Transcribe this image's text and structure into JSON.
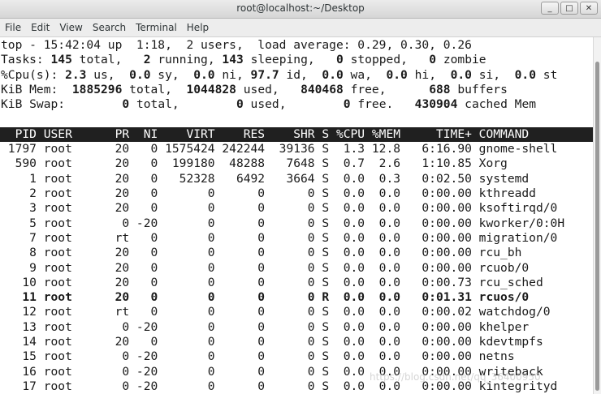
{
  "window": {
    "title": "root@localhost:~/Desktop"
  },
  "menu": [
    "File",
    "Edit",
    "View",
    "Search",
    "Terminal",
    "Help"
  ],
  "summary": {
    "uptime": "top - 15:42:04 up  1:18,  2 users,  load average: 0.29, 0.30, 0.26",
    "tasks": [
      "Tasks: ",
      "145",
      " total,   ",
      "2",
      " running, ",
      "143",
      " sleeping,   ",
      "0",
      " stopped,   ",
      "0",
      " zombie"
    ],
    "cpu": [
      "%Cpu(s): ",
      "2.3",
      " us,  ",
      "0.0",
      " sy,  ",
      "0.0",
      " ni, ",
      "97.7",
      " id,  ",
      "0.0",
      " wa,  ",
      "0.0",
      " hi,  ",
      "0.0",
      " si,  ",
      "0.0",
      " st"
    ],
    "mem": [
      "KiB Mem:  ",
      "1885296",
      " total,  ",
      "1044828",
      " used,   ",
      "840468",
      " free,      ",
      "688",
      " buffers"
    ],
    "swap": [
      "KiB Swap:        ",
      "0",
      " total,        ",
      "0",
      " used,        ",
      "0",
      " free.   ",
      "430904",
      " cached Mem"
    ]
  },
  "header": "  PID USER      PR  NI    VIRT    RES    SHR S %CPU %MEM     TIME+ COMMAND     ",
  "processes": [
    [
      "1797",
      "root",
      "20",
      "0",
      "1575424",
      "242244",
      "39136",
      "S",
      "1.3",
      "12.8",
      "6:16.90",
      "gnome-shell"
    ],
    [
      "590",
      "root",
      "20",
      "0",
      "199180",
      "48288",
      "7648",
      "S",
      "0.7",
      "2.6",
      "1:10.85",
      "Xorg"
    ],
    [
      "1",
      "root",
      "20",
      "0",
      "52328",
      "6492",
      "3664",
      "S",
      "0.0",
      "0.3",
      "0:02.50",
      "systemd"
    ],
    [
      "2",
      "root",
      "20",
      "0",
      "0",
      "0",
      "0",
      "S",
      "0.0",
      "0.0",
      "0:00.00",
      "kthreadd"
    ],
    [
      "3",
      "root",
      "20",
      "0",
      "0",
      "0",
      "0",
      "S",
      "0.0",
      "0.0",
      "0:00.00",
      "ksoftirqd/0"
    ],
    [
      "5",
      "root",
      "0",
      "-20",
      "0",
      "0",
      "0",
      "S",
      "0.0",
      "0.0",
      "0:00.00",
      "kworker/0:0H"
    ],
    [
      "7",
      "root",
      "rt",
      "0",
      "0",
      "0",
      "0",
      "S",
      "0.0",
      "0.0",
      "0:00.00",
      "migration/0"
    ],
    [
      "8",
      "root",
      "20",
      "0",
      "0",
      "0",
      "0",
      "S",
      "0.0",
      "0.0",
      "0:00.00",
      "rcu_bh"
    ],
    [
      "9",
      "root",
      "20",
      "0",
      "0",
      "0",
      "0",
      "S",
      "0.0",
      "0.0",
      "0:00.00",
      "rcuob/0"
    ],
    [
      "10",
      "root",
      "20",
      "0",
      "0",
      "0",
      "0",
      "S",
      "0.0",
      "0.0",
      "0:00.73",
      "rcu_sched"
    ],
    [
      "11",
      "root",
      "20",
      "0",
      "0",
      "0",
      "0",
      "R",
      "0.0",
      "0.0",
      "0:01.31",
      "rcuos/0"
    ],
    [
      "12",
      "root",
      "rt",
      "0",
      "0",
      "0",
      "0",
      "S",
      "0.0",
      "0.0",
      "0:00.02",
      "watchdog/0"
    ],
    [
      "13",
      "root",
      "0",
      "-20",
      "0",
      "0",
      "0",
      "S",
      "0.0",
      "0.0",
      "0:00.00",
      "khelper"
    ],
    [
      "14",
      "root",
      "20",
      "0",
      "0",
      "0",
      "0",
      "S",
      "0.0",
      "0.0",
      "0:00.00",
      "kdevtmpfs"
    ],
    [
      "15",
      "root",
      "0",
      "-20",
      "0",
      "0",
      "0",
      "S",
      "0.0",
      "0.0",
      "0:00.00",
      "netns"
    ],
    [
      "16",
      "root",
      "0",
      "-20",
      "0",
      "0",
      "0",
      "S",
      "0.0",
      "0.0",
      "0:00.00",
      "writeback"
    ],
    [
      "17",
      "root",
      "0",
      "-20",
      "0",
      "0",
      "0",
      "S",
      "0.0",
      "0.0",
      "0:00.00",
      "kintegrityd"
    ]
  ],
  "highlighted_pid": "11",
  "watermark": "https://blog.csdn.net/qq_36400950",
  "colors": {
    "header_bg": "#202020",
    "header_fg": "#ffffff",
    "text": "#1a1a1a"
  }
}
